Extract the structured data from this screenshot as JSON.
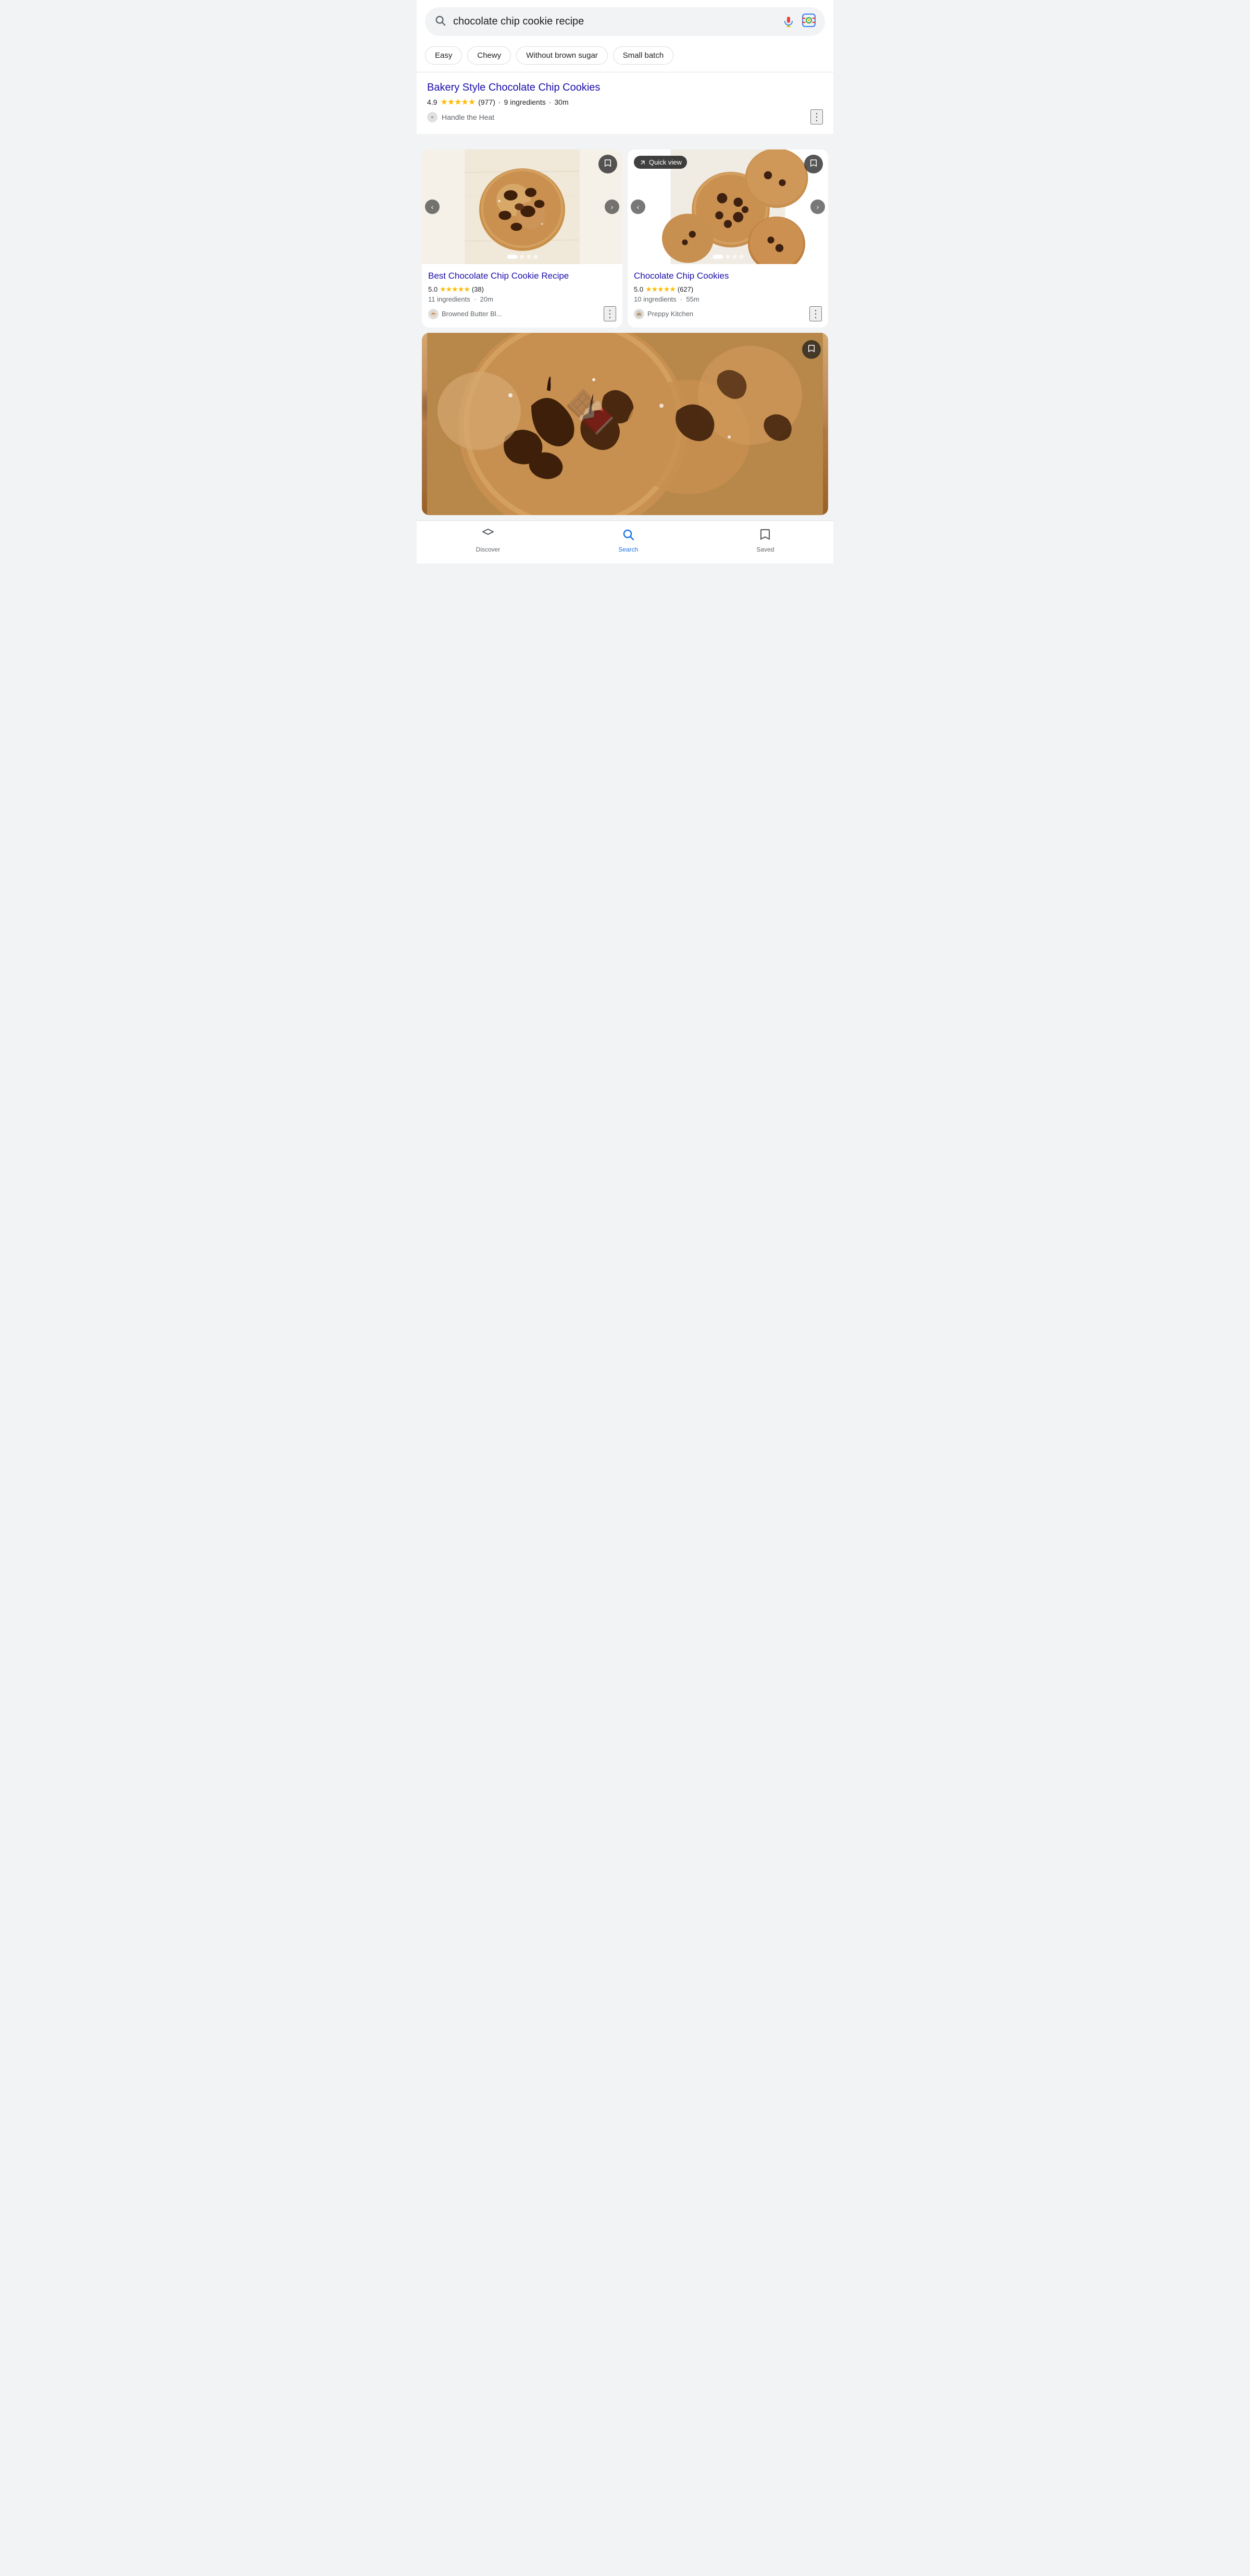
{
  "search": {
    "query": "chocolate chip cookie recipe",
    "mic_label": "voice search",
    "lens_label": "image search"
  },
  "chips": [
    {
      "id": "easy",
      "label": "Easy"
    },
    {
      "id": "chewy",
      "label": "Chewy"
    },
    {
      "id": "without-brown-sugar",
      "label": "Without brown sugar"
    },
    {
      "id": "small-batch",
      "label": "Small batch"
    }
  ],
  "featured_result": {
    "title": "Bakery Style Chocolate Chip Cookies",
    "url": "#",
    "rating": "4.9",
    "stars": "★★★★★",
    "review_count": "(977)",
    "ingredients": "9 ingredients",
    "time": "30m",
    "source": "Handle the Heat",
    "more_options_label": "⋮"
  },
  "recipe_cards": [
    {
      "id": "card1",
      "title": "Best Chocolate Chip Cookie Recipe",
      "rating": "5.0",
      "stars": "★★★★★",
      "review_count": "(38)",
      "ingredients": "11 ingredients",
      "time": "20m",
      "source": "Browned Butter Bl...",
      "has_quick_view": false,
      "dots": [
        true,
        false,
        false,
        false
      ],
      "carousel_label": "carousel"
    },
    {
      "id": "card2",
      "title": "Chocolate Chip Cookies",
      "rating": "5.0",
      "stars": "★★★★★",
      "review_count": "(627)",
      "ingredients": "10 ingredients",
      "time": "55m",
      "source": "Preppy Kitchen",
      "has_quick_view": true,
      "quick_view_label": "Quick view",
      "dots": [
        true,
        false,
        false,
        false
      ],
      "carousel_label": "carousel"
    }
  ],
  "large_card": {
    "bookmark_label": "save recipe"
  },
  "bottom_nav": {
    "discover_label": "Discover",
    "search_label": "Search",
    "saved_label": "Saved"
  }
}
